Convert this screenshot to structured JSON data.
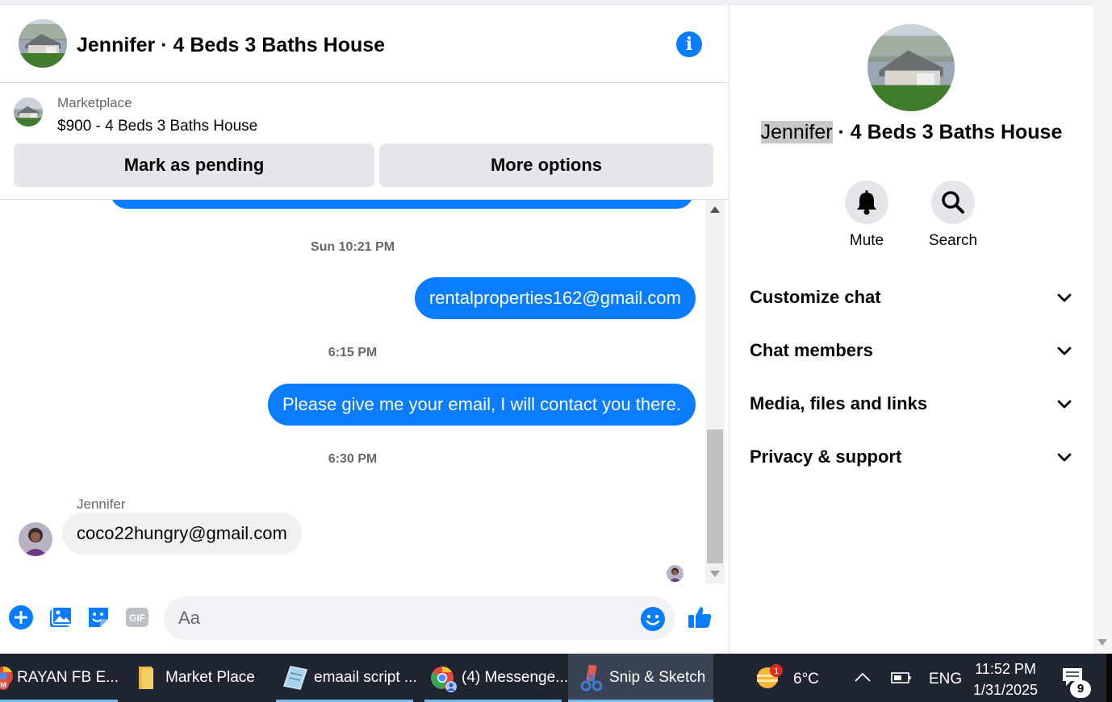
{
  "chat": {
    "title": "Jennifer · 4 Beds 3 Baths House",
    "info_icon": "info-icon"
  },
  "listing": {
    "source": "Marketplace",
    "title": "$900 - 4 Beds 3 Baths House",
    "mark_pending_label": "Mark as pending",
    "more_options_label": "More options"
  },
  "messages": [
    {
      "type": "timestamp",
      "text": "Sun 10:21 PM"
    },
    {
      "type": "outgoing",
      "text": "rentalproperties162@gmail.com"
    },
    {
      "type": "timestamp",
      "text": "6:15 PM"
    },
    {
      "type": "outgoing",
      "text": "Please give me your email, I will contact you there."
    },
    {
      "type": "timestamp",
      "text": "6:30 PM"
    },
    {
      "type": "incoming",
      "sender": "Jennifer",
      "text": "coco22hungry@gmail.com"
    }
  ],
  "composer": {
    "placeholder": "Aa",
    "icons": [
      "plus-icon",
      "image-icon",
      "sticker-icon",
      "gif-icon",
      "emoji-icon",
      "thumbs-up-icon"
    ],
    "gif_text": "GIF"
  },
  "info_panel": {
    "name_highlight": "Jennifer",
    "name_rest": " · 4 Beds 3 Baths House",
    "actions": [
      {
        "label": "Mute",
        "icon": "bell-icon"
      },
      {
        "label": "Search",
        "icon": "search-icon"
      }
    ],
    "sections": [
      "Customize chat",
      "Chat members",
      "Media, files and links",
      "Privacy & support"
    ]
  },
  "taskbar": {
    "tasks": [
      {
        "label": "RAYAN FB E...",
        "icon": "chrome-profile-icon"
      },
      {
        "label": "Market Place",
        "icon": "folder-icon"
      },
      {
        "label": "emaail script ...",
        "icon": "notepad-icon"
      },
      {
        "label": "(4) Messenge...",
        "icon": "chrome-icon"
      },
      {
        "label": "Snip & Sketch",
        "icon": "snip-sketch-icon"
      }
    ],
    "weather_badge": "1",
    "temperature": "6°C",
    "language": "ENG",
    "time": "11:52 PM",
    "date": "1/31/2025",
    "notifications": "9"
  },
  "colors": {
    "messenger_blue": "#0a7cff",
    "taskbar_bg": "#1f2632",
    "incoming_bubble": "#f0f0f0"
  }
}
